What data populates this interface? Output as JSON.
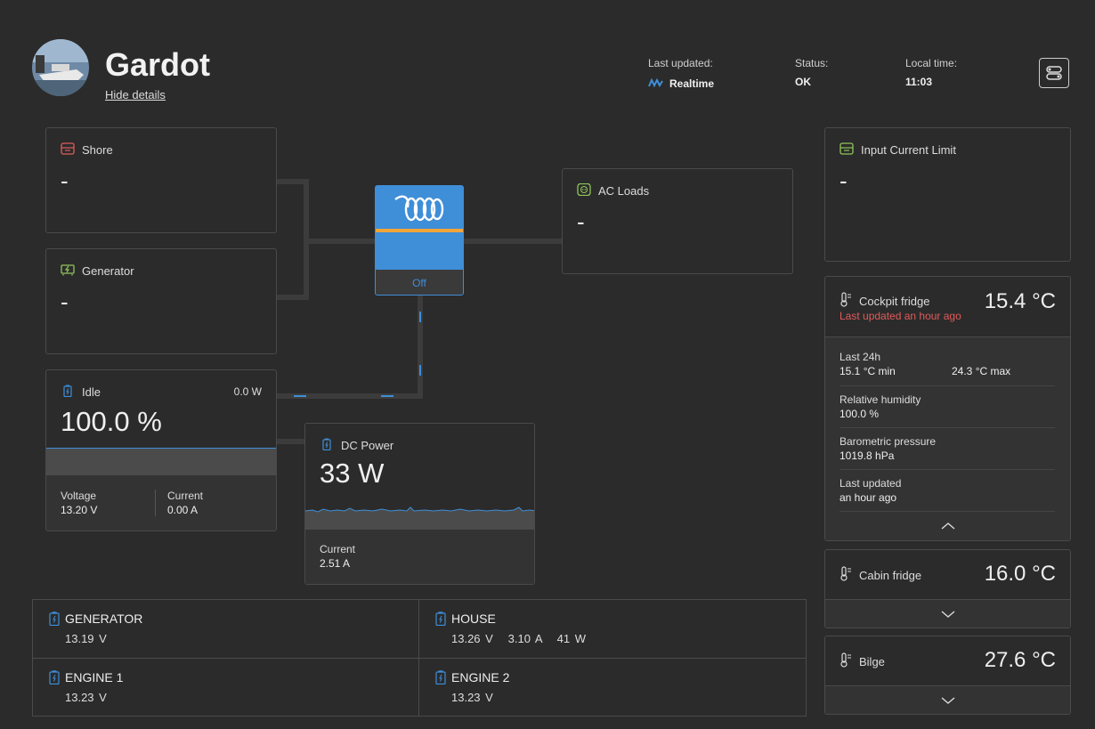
{
  "header": {
    "site_name": "Gardot",
    "hide_details": "Hide details",
    "last_updated_label": "Last updated:",
    "last_updated_value": "Realtime",
    "status_label": "Status:",
    "status_value": "OK",
    "local_time_label": "Local time:",
    "local_time_value": "11:03"
  },
  "shore": {
    "title": "Shore",
    "value": "-"
  },
  "generator": {
    "title": "Generator",
    "value": "-"
  },
  "inverter": {
    "state": "Off"
  },
  "ac_loads": {
    "title": "AC Loads",
    "value": "-"
  },
  "battery": {
    "title": "Idle",
    "power": "0.0 W",
    "soc": "100.0 %",
    "voltage_label": "Voltage",
    "voltage_value": "13.20 V",
    "current_label": "Current",
    "current_value": "0.00 A"
  },
  "dc_power": {
    "title": "DC Power",
    "value": "33 W",
    "current_label": "Current",
    "current_value": "2.51 A"
  },
  "batteries": [
    {
      "name": "GENERATOR",
      "values": "13.19 V"
    },
    {
      "name": "HOUSE",
      "values": "13.26 V   3.10 A   41 W"
    },
    {
      "name": "ENGINE 1",
      "values": "13.23 V"
    },
    {
      "name": "ENGINE 2",
      "values": "13.23 V"
    }
  ],
  "input_limit": {
    "title": "Input Current Limit",
    "value": "-"
  },
  "cockpit_fridge": {
    "title": "Cockpit fridge",
    "temp": "15.4 °C",
    "warning": "Last updated an hour ago",
    "last24_label": "Last 24h",
    "min": "15.1 °C min",
    "max": "24.3 °C max",
    "humidity_label": "Relative humidity",
    "humidity_value": "100.0 %",
    "pressure_label": "Barometric pressure",
    "pressure_value": "1019.8 hPa",
    "updated_label": "Last updated",
    "updated_value": "an hour ago"
  },
  "cabin_fridge": {
    "title": "Cabin fridge",
    "temp": "16.0 °C"
  },
  "bilge": {
    "title": "Bilge",
    "temp": "27.6 °C"
  },
  "colors": {
    "background": "#2b2b2b",
    "accent_blue": "#3f8ed8",
    "inverter_orange": "#f2a53a",
    "warning_red": "#e15a5a",
    "shore_icon": "#e25b5b",
    "generator_icon": "#8fc55a"
  }
}
